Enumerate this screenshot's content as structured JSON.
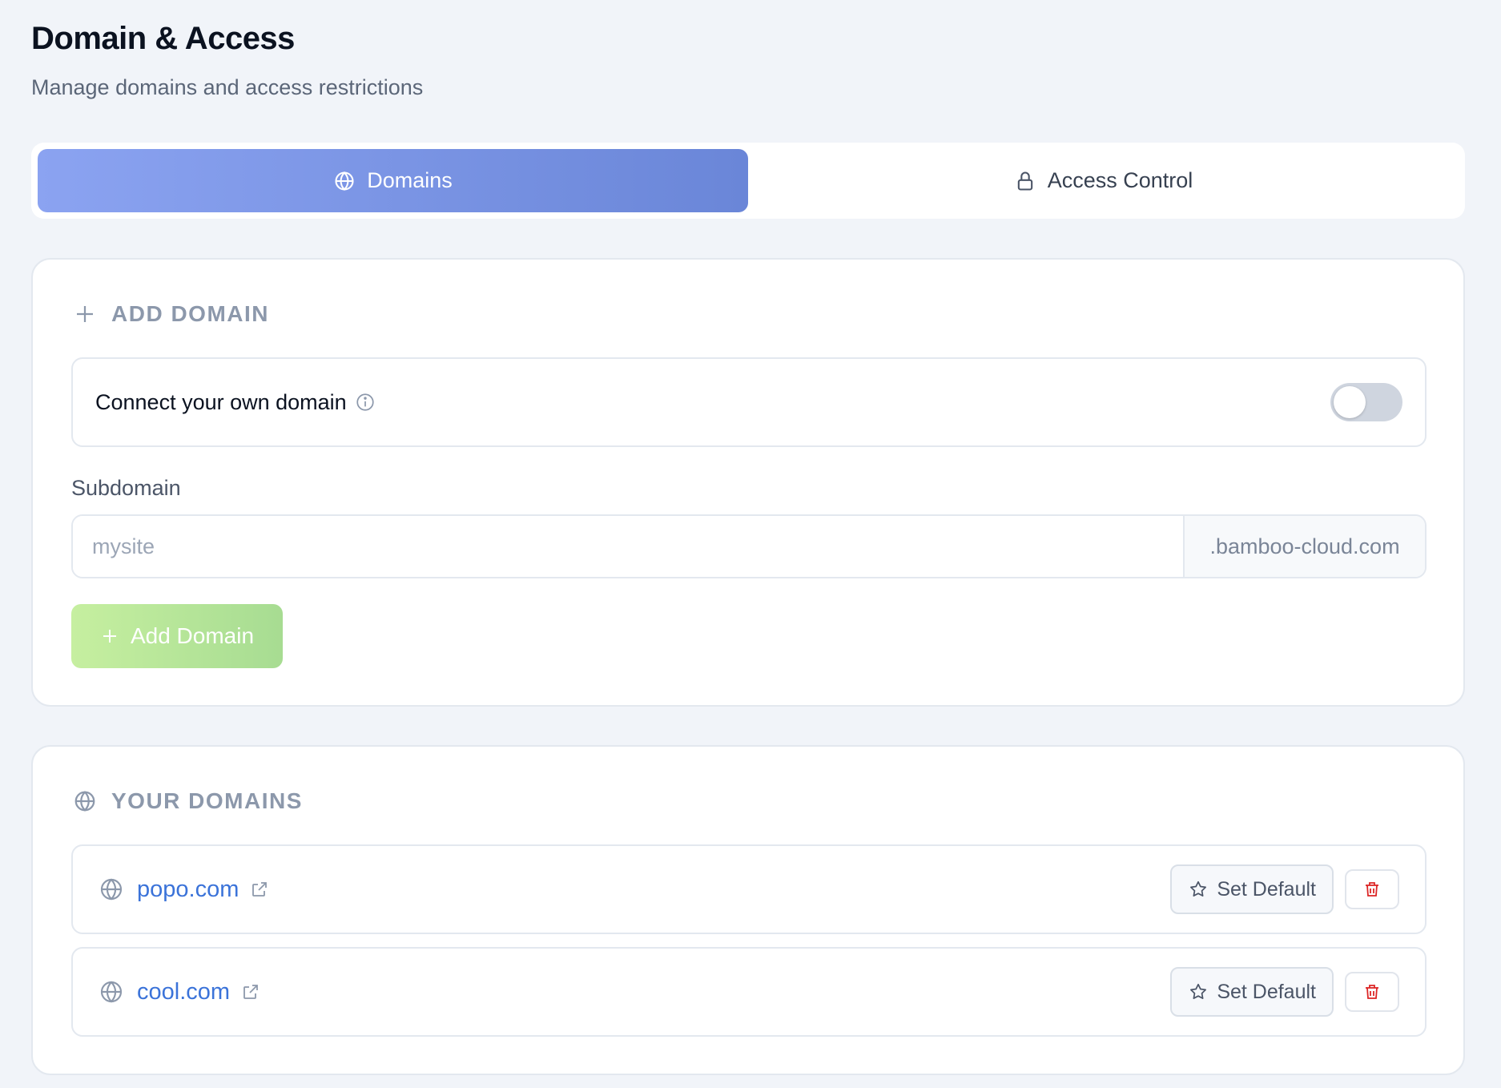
{
  "header": {
    "title": "Domain & Access",
    "subtitle": "Manage domains and access restrictions"
  },
  "tabs": [
    {
      "label": "Domains",
      "icon": "globe-icon",
      "active": true
    },
    {
      "label": "Access Control",
      "icon": "lock-icon",
      "active": false
    }
  ],
  "add_domain": {
    "heading": "ADD DOMAIN",
    "toggle_label": "Connect your own domain",
    "toggle_on": false,
    "subdomain_label": "Subdomain",
    "subdomain_value": "",
    "subdomain_placeholder": "mysite",
    "suffix": ".bamboo-cloud.com",
    "button_label": "Add Domain"
  },
  "your_domains": {
    "heading": "YOUR DOMAINS",
    "items": [
      {
        "name": "popo.com",
        "set_default_label": "Set Default"
      },
      {
        "name": "cool.com",
        "set_default_label": "Set Default"
      }
    ]
  },
  "colors": {
    "accent": "#7b93e4",
    "link": "#3b73d9",
    "add_button": "#b5e69a",
    "danger": "#dc2626",
    "background": "#f1f4f9"
  }
}
